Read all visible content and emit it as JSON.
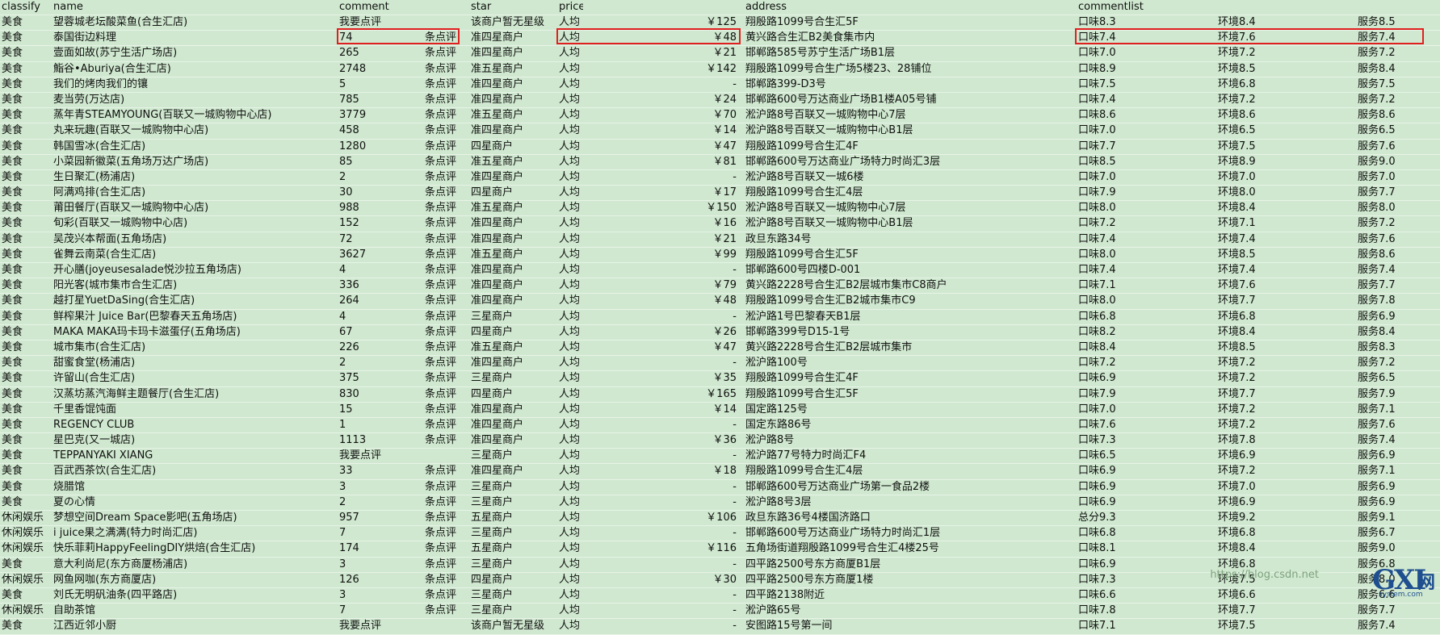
{
  "headers": {
    "classify": "classify",
    "name": "name",
    "comment": "comment",
    "star": "star",
    "price": "price",
    "address": "address",
    "commentlist": "commentlist"
  },
  "rows": [
    [
      "美食",
      "望蓉城老坛酸菜鱼(合生汇店)",
      "我要点评",
      "",
      "该商户暂无星级",
      "人均",
      "￥125",
      "翔殷路1099号合生汇5F",
      "口味8.3",
      "环境8.4",
      "服务8.5"
    ],
    [
      "美食",
      "泰国街边料理",
      "74",
      "条点评",
      "准四星商户",
      "人均",
      "￥48",
      "黄兴路合生汇B2美食集市内",
      "口味7.4",
      "环境7.6",
      "服务7.4"
    ],
    [
      "美食",
      "壹面如故(苏宁生活广场店)",
      "265",
      "条点评",
      "准四星商户",
      "人均",
      "￥21",
      "邯郸路585号苏宁生活广场B1层",
      "口味7.0",
      "环境7.2",
      "服务7.2"
    ],
    [
      "美食",
      "鮨谷•Aburiya(合生汇店)",
      "2748",
      "条点评",
      "准五星商户",
      "人均",
      "￥142",
      "翔殷路1099号合生广场5楼23、28铺位",
      "口味8.9",
      "环境8.5",
      "服务8.4"
    ],
    [
      "美食",
      "我们的烤肉我们的镶",
      "5",
      "条点评",
      "准四星商户",
      "人均",
      "-",
      "邯郸路399-D3号",
      "口味7.5",
      "环境6.8",
      "服务7.5"
    ],
    [
      "美食",
      "麦当劳(万达店)",
      "785",
      "条点评",
      "准四星商户",
      "人均",
      "￥24",
      "邯郸路600号万达商业广场B1楼A05号铺",
      "口味7.4",
      "环境7.2",
      "服务7.2"
    ],
    [
      "美食",
      "蒸年青STEAMYOUNG(百联又一城购物中心店)",
      "3779",
      "条点评",
      "准五星商户",
      "人均",
      "￥70",
      "淞沪路8号百联又一城购物中心7层",
      "口味8.6",
      "环境8.6",
      "服务8.6"
    ],
    [
      "美食",
      "丸来玩趣(百联又一城购物中心店)",
      "458",
      "条点评",
      "准四星商户",
      "人均",
      "￥14",
      "淞沪路8号百联又一城购物中心B1层",
      "口味7.0",
      "环境6.5",
      "服务6.5"
    ],
    [
      "美食",
      "韩国雪冰(合生汇店)",
      "1280",
      "条点评",
      "四星商户",
      "人均",
      "￥47",
      "翔殷路1099号合生汇4F",
      "口味7.7",
      "环境7.5",
      "服务7.6"
    ],
    [
      "美食",
      "小菜园新徽菜(五角场万达广场店)",
      "85",
      "条点评",
      "准五星商户",
      "人均",
      "￥81",
      "邯郸路600号万达商业广场特力时尚汇3层",
      "口味8.5",
      "环境8.9",
      "服务9.0"
    ],
    [
      "美食",
      "生日聚汇(杨浦店)",
      "2",
      "条点评",
      "准四星商户",
      "人均",
      "-",
      "淞沪路8号百联又一城6楼",
      "口味7.0",
      "环境7.0",
      "服务7.0"
    ],
    [
      "美食",
      "阿满鸡排(合生汇店)",
      "30",
      "条点评",
      "四星商户",
      "人均",
      "￥17",
      "翔殷路1099号合生汇4层",
      "口味7.9",
      "环境8.0",
      "服务7.7"
    ],
    [
      "美食",
      "莆田餐厅(百联又一城购物中心店)",
      "988",
      "条点评",
      "准五星商户",
      "人均",
      "￥150",
      "淞沪路8号百联又一城购物中心7层",
      "口味8.0",
      "环境8.4",
      "服务8.0"
    ],
    [
      "美食",
      "旬彩(百联又一城购物中心店)",
      "152",
      "条点评",
      "准四星商户",
      "人均",
      "￥16",
      "淞沪路8号百联又一城购物中心B1层",
      "口味7.2",
      "环境7.1",
      "服务7.2"
    ],
    [
      "美食",
      "吴茂兴本帮面(五角场店)",
      "72",
      "条点评",
      "准四星商户",
      "人均",
      "￥21",
      "政旦东路34号",
      "口味7.4",
      "环境7.4",
      "服务7.6"
    ],
    [
      "美食",
      "雀舞云南菜(合生汇店)",
      "3627",
      "条点评",
      "准五星商户",
      "人均",
      "￥99",
      "翔殷路1099号合生汇5F",
      "口味8.0",
      "环境8.5",
      "服务8.6"
    ],
    [
      "美食",
      "开心膳(joyeusesalade悦沙拉五角场店)",
      "4",
      "条点评",
      "准四星商户",
      "人均",
      "-",
      "邯郸路600号四楼D-001",
      "口味7.4",
      "环境7.4",
      "服务7.4"
    ],
    [
      "美食",
      "阳光客(城市集市合生汇店)",
      "336",
      "条点评",
      "准四星商户",
      "人均",
      "￥79",
      "黄兴路2228号合生汇B2层城市集市C8商户",
      "口味7.1",
      "环境7.6",
      "服务7.7"
    ],
    [
      "美食",
      "越打星YuetDaSing(合生汇店)",
      "264",
      "条点评",
      "准四星商户",
      "人均",
      "￥48",
      "翔殷路1099号合生汇B2城市集市C9",
      "口味8.0",
      "环境7.7",
      "服务7.8"
    ],
    [
      "美食",
      "鲜榨果汁 Juice Bar(巴黎春天五角场店)",
      "4",
      "条点评",
      "三星商户",
      "人均",
      "-",
      "淞沪路1号巴黎春天B1层",
      "口味6.8",
      "环境6.8",
      "服务6.9"
    ],
    [
      "美食",
      "MAKA MAKA玛卡玛卡滋蛋仔(五角场店)",
      "67",
      "条点评",
      "四星商户",
      "人均",
      "￥26",
      "邯郸路399号D15-1号",
      "口味8.2",
      "环境8.4",
      "服务8.4"
    ],
    [
      "美食",
      "城市集市(合生汇店)",
      "226",
      "条点评",
      "准五星商户",
      "人均",
      "￥47",
      "黄兴路2228号合生汇B2层城市集市",
      "口味8.4",
      "环境8.5",
      "服务8.3"
    ],
    [
      "美食",
      "甜蜜食堂(杨浦店)",
      "2",
      "条点评",
      "准四星商户",
      "人均",
      "-",
      "淞沪路100号",
      "口味7.2",
      "环境7.2",
      "服务7.2"
    ],
    [
      "美食",
      "许留山(合生汇店)",
      "375",
      "条点评",
      "三星商户",
      "人均",
      "￥35",
      "翔殷路1099号合生汇4F",
      "口味6.9",
      "环境7.2",
      "服务6.5"
    ],
    [
      "美食",
      "汉蒸坊蒸汽海鲜主题餐厅(合生汇店)",
      "830",
      "条点评",
      "四星商户",
      "人均",
      "￥165",
      "翔殷路1099号合生汇5F",
      "口味7.9",
      "环境7.7",
      "服务7.9"
    ],
    [
      "美食",
      "千里香馄饨面",
      "15",
      "条点评",
      "准四星商户",
      "人均",
      "￥14",
      "国定路125号",
      "口味7.0",
      "环境7.2",
      "服务7.1"
    ],
    [
      "美食",
      "REGENCY CLUB",
      "1",
      "条点评",
      "准四星商户",
      "人均",
      "-",
      "国定东路86号",
      "口味7.6",
      "环境7.2",
      "服务7.6"
    ],
    [
      "美食",
      "星巴克(又一城店)",
      "1113",
      "条点评",
      "准四星商户",
      "人均",
      "￥36",
      "淞沪路8号",
      "口味7.3",
      "环境7.8",
      "服务7.4"
    ],
    [
      "美食",
      "TEPPANYAKI XIANG",
      "我要点评",
      "",
      "三星商户",
      "人均",
      "-",
      "淞沪路77号特力时尚汇F4",
      "口味6.5",
      "环境6.9",
      "服务6.9"
    ],
    [
      "美食",
      "百武西茶饮(合生汇店)",
      "33",
      "条点评",
      "准四星商户",
      "人均",
      "￥18",
      "翔殷路1099号合生汇4层",
      "口味6.9",
      "环境7.2",
      "服务7.1"
    ],
    [
      "美食",
      "烧腊馆",
      "3",
      "条点评",
      "三星商户",
      "人均",
      "-",
      "邯郸路600号万达商业广场第一食品2楼",
      "口味6.9",
      "环境7.0",
      "服务6.9"
    ],
    [
      "美食",
      "夏の心情",
      "2",
      "条点评",
      "三星商户",
      "人均",
      "-",
      "淞沪路8号3层",
      "口味6.9",
      "环境6.9",
      "服务6.9"
    ],
    [
      "休闲娱乐",
      "梦想空间Dream Space影吧(五角场店)",
      "957",
      "条点评",
      "五星商户",
      "人均",
      "￥106",
      "政旦东路36号4楼国济路口",
      "总分9.3",
      "环境9.2",
      "服务9.1"
    ],
    [
      "休闲娱乐",
      "i juice果之满满(特力时尚汇店)",
      "7",
      "条点评",
      "三星商户",
      "人均",
      "-",
      "邯郸路600号万达商业广场特力时尚汇1层",
      "口味6.8",
      "环境6.8",
      "服务6.7"
    ],
    [
      "休闲娱乐",
      "快乐菲莉HappyFeelingDIY烘焙(合生汇店)",
      "174",
      "条点评",
      "五星商户",
      "人均",
      "￥116",
      "五角场街道翔殷路1099号合生汇4楼25号",
      "口味8.1",
      "环境8.4",
      "服务9.0"
    ],
    [
      "美食",
      "意大利尚尼(东方商厦杨浦店)",
      "3",
      "条点评",
      "三星商户",
      "人均",
      "-",
      "四平路2500号东方商厦B1层",
      "口味6.9",
      "环境6.8",
      "服务6.8"
    ],
    [
      "休闲娱乐",
      "网鱼网咖(东方商厦店)",
      "126",
      "条点评",
      "四星商户",
      "人均",
      "￥30",
      "四平路2500号东方商厦1楼",
      "口味7.3",
      "环境7.5",
      "服务8.0"
    ],
    [
      "美食",
      "刘氏无明矾油条(四平路店)",
      "3",
      "条点评",
      "三星商户",
      "人均",
      "-",
      "四平路2138附近",
      "口味6.6",
      "环境6.6",
      "服务6.6"
    ],
    [
      "休闲娱乐",
      "自助茶馆",
      "7",
      "条点评",
      "三星商户",
      "人均",
      "-",
      "淞沪路65号",
      "口味7.8",
      "环境7.7",
      "服务7.7"
    ],
    [
      "美食",
      "江西近邻小厨",
      "我要点评",
      "",
      "该商户暂无星级",
      "人均",
      "-",
      "安图路15号第一间",
      "口味7.1",
      "环境7.5",
      "服务7.4"
    ]
  ],
  "watermark": "https://blog.csdn.net",
  "logo": {
    "big": "GXI",
    "cn": "网",
    "small": "system.com"
  }
}
